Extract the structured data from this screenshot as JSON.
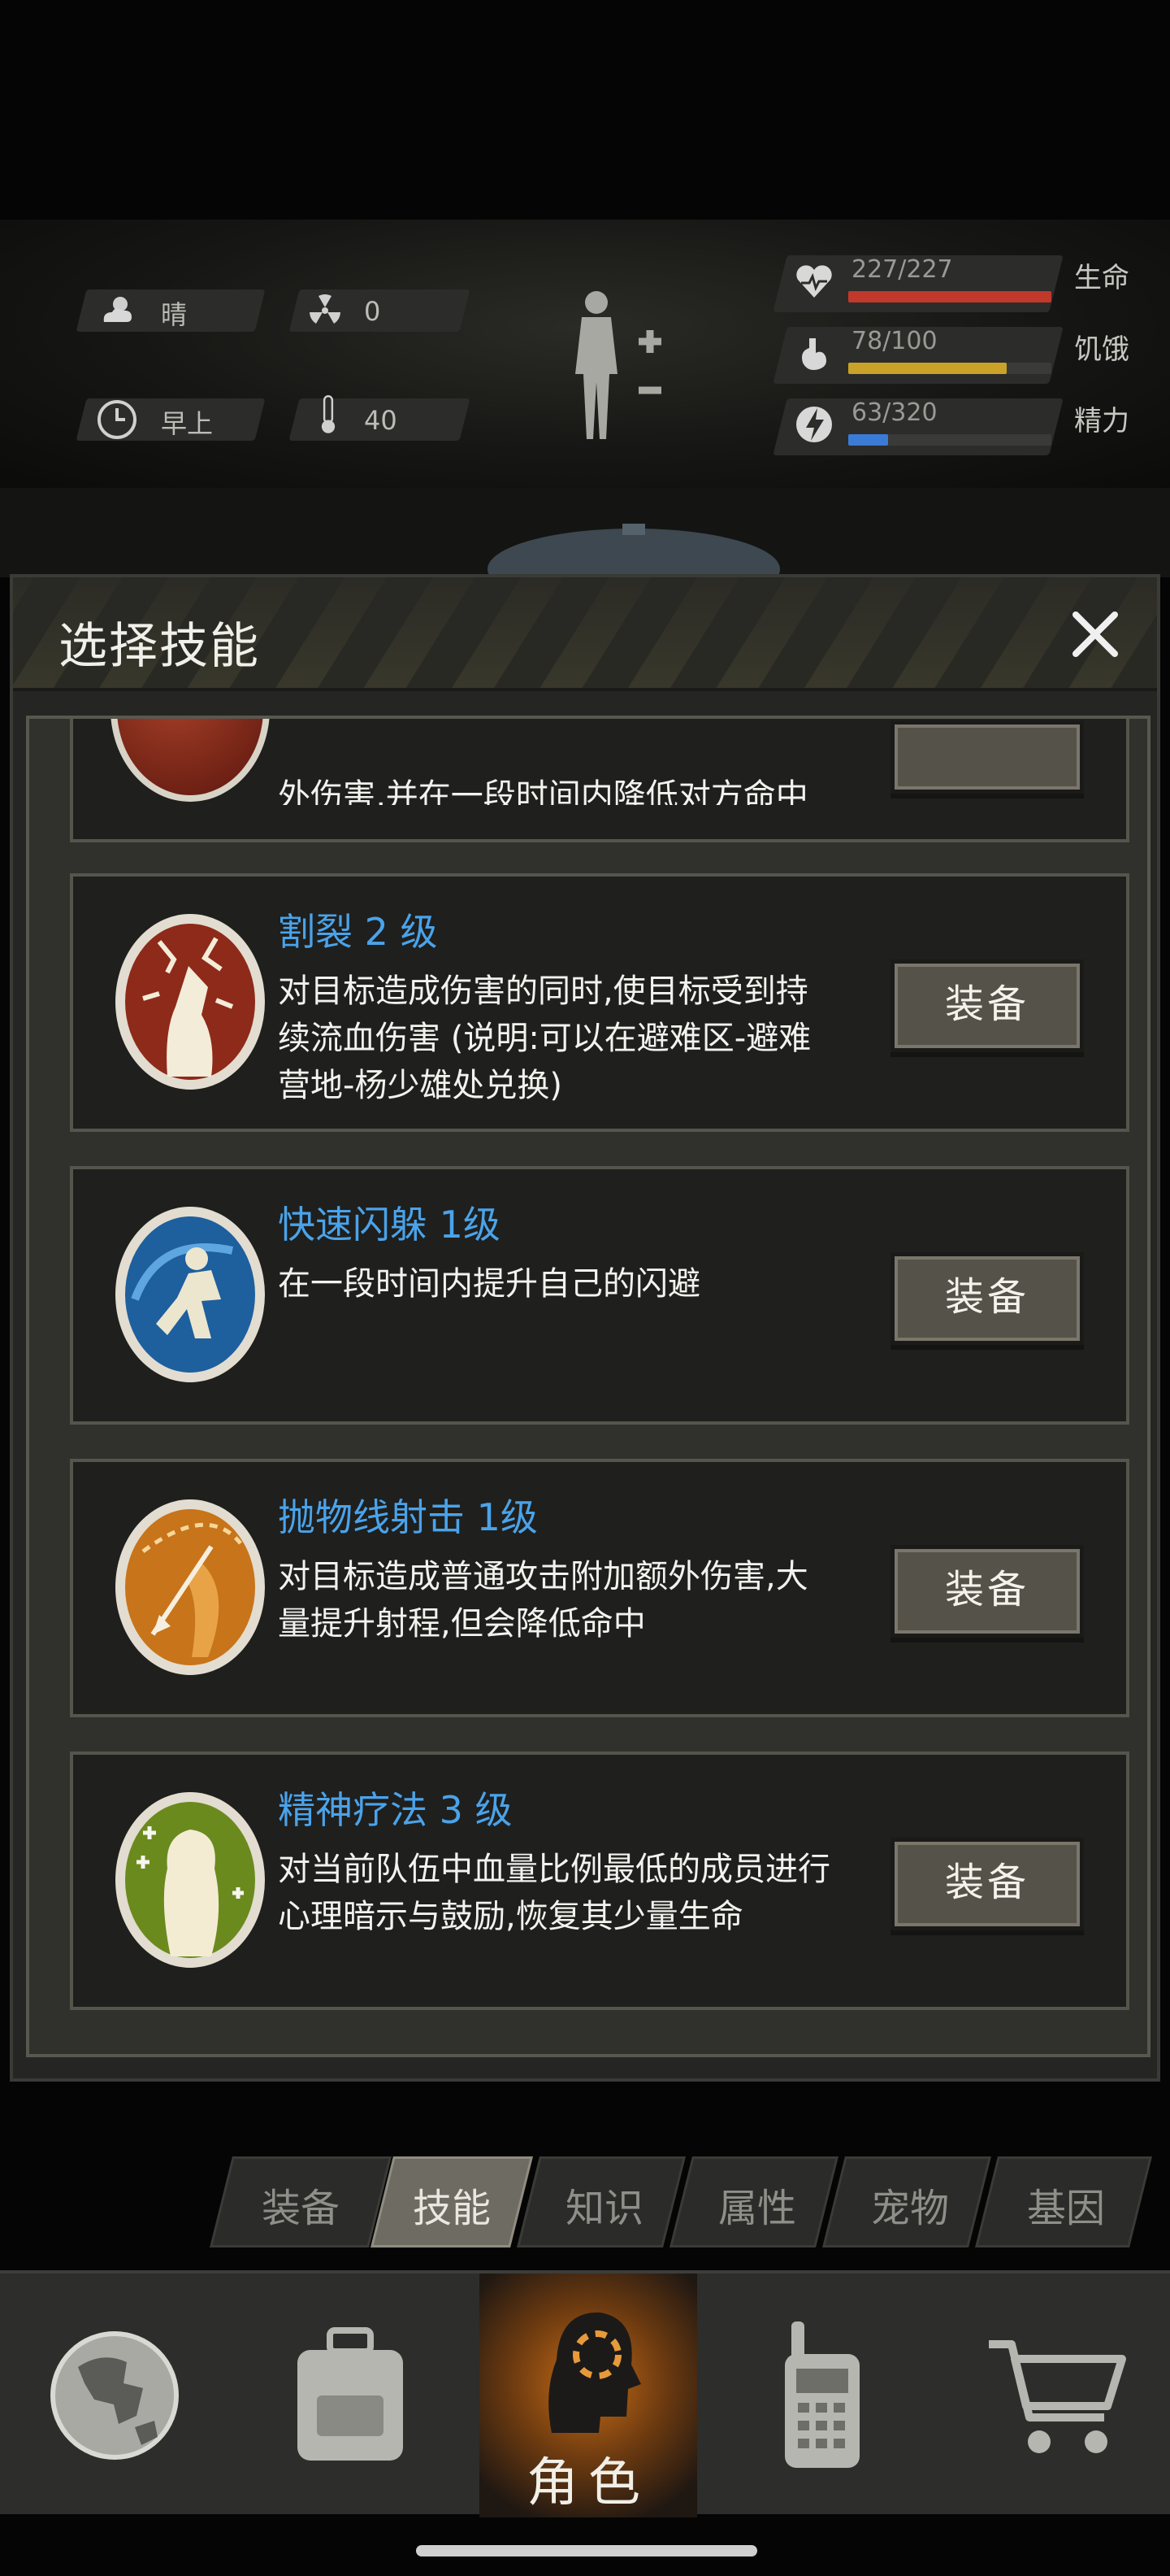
{
  "status": {
    "weather": {
      "label": "晴",
      "icon": "cloud-sun-icon"
    },
    "radiation": {
      "value": "0",
      "icon": "radiation-icon"
    },
    "time": {
      "label": "早上",
      "icon": "clock-icon"
    },
    "temperature": {
      "value": "40",
      "icon": "thermometer-icon"
    },
    "vitals": [
      {
        "name": "生命",
        "value": "227/227",
        "fraction": 1.0,
        "color": "#c0392b",
        "icon": "heart-icon"
      },
      {
        "name": "饥饿",
        "value": "78/100",
        "fraction": 0.78,
        "color": "#c9a227",
        "icon": "stomach-icon"
      },
      {
        "name": "精力",
        "value": "63/320",
        "fraction": 0.197,
        "color": "#3a7bd5",
        "icon": "lightning-icon"
      }
    ]
  },
  "dialog": {
    "title": "选择技能",
    "close_icon": "close-icon",
    "partial_item_desc": "外伤害,并在一段时间内降低对方命中",
    "skills": [
      {
        "name": "割裂 2 级",
        "desc": "对目标造成伤害的同时,使目标受到持续流血伤害 (说明:可以在避难区-避难营地-杨少雄处兑换)",
        "equip_label": "装备",
        "icon": "laceration-icon",
        "color": "#8e2a1a"
      },
      {
        "name": "快速闪躲 1级",
        "desc": "在一段时间内提升自己的闪避",
        "equip_label": "装备",
        "icon": "dodge-icon",
        "color": "#1e5f9e"
      },
      {
        "name": "抛物线射击 1级",
        "desc": "对目标造成普通攻击附加额外伤害,大量提升射程,但会降低命中",
        "equip_label": "装备",
        "icon": "parabolic-shot-icon",
        "color": "#c8741a"
      },
      {
        "name": "精神疗法 3 级",
        "desc": "对当前队伍中血量比例最低的成员进行心理暗示与鼓励,恢复其少量生命",
        "equip_label": "装备",
        "icon": "spirit-therapy-icon",
        "color": "#6b8a1e"
      }
    ]
  },
  "tabs": [
    {
      "label": "装备",
      "active": false
    },
    {
      "label": "技能",
      "active": true
    },
    {
      "label": "知识",
      "active": false
    },
    {
      "label": "属性",
      "active": false
    },
    {
      "label": "宠物",
      "active": false
    },
    {
      "label": "基因",
      "active": false
    }
  ],
  "nav": {
    "world_icon": "globe-icon",
    "bag_icon": "backpack-icon",
    "character": {
      "label": "角色",
      "icon": "character-head-icon"
    },
    "radio_icon": "walkie-talkie-icon",
    "shop_icon": "cart-icon"
  }
}
